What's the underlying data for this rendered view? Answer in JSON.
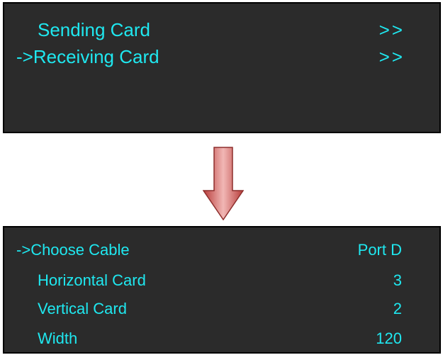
{
  "screens": [
    {
      "items": [
        {
          "cursor": "",
          "label": "Sending Card",
          "value": ">>"
        },
        {
          "cursor": "->",
          "label": "Receiving Card",
          "value": ">>"
        }
      ]
    },
    {
      "items": [
        {
          "cursor": "->",
          "label": "Choose Cable",
          "value": "Port D"
        },
        {
          "cursor": "",
          "label": "Horizontal Card",
          "value": "3"
        },
        {
          "cursor": "",
          "label": "Vertical Card",
          "value": "2"
        },
        {
          "cursor": "",
          "label": "Width",
          "value": "120"
        }
      ]
    }
  ],
  "colors": {
    "screen_background": "#2b2b2b",
    "screen_text": "#1fe8f0",
    "arrow": "#c0504d"
  },
  "icons": {
    "transition": "down-arrow-icon"
  }
}
